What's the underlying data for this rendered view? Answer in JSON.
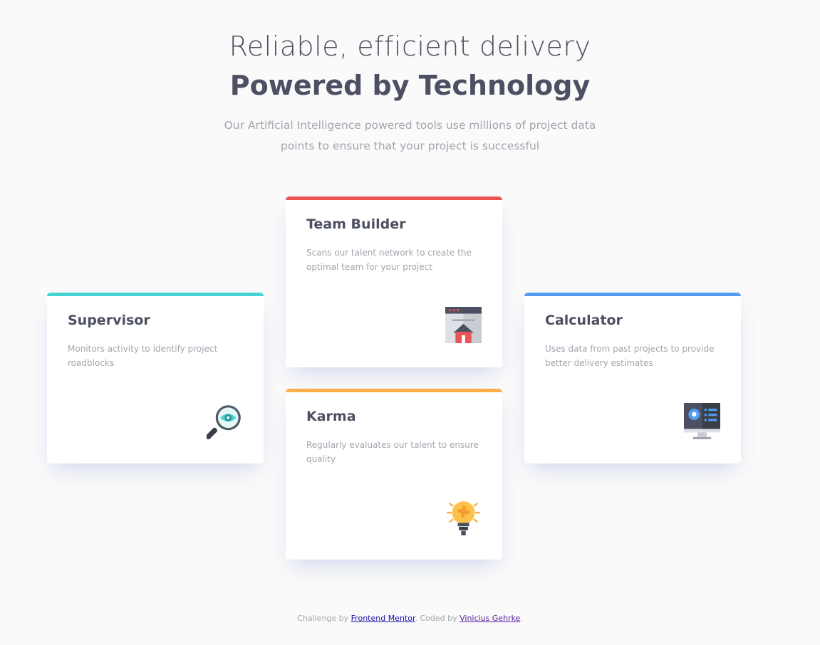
{
  "header": {
    "title_light": "Reliable, efficient delivery",
    "title_bold": "Powered by Technology",
    "subtitle": "Our Artificial Intelligence powered tools use millions of project data points to ensure that your project is successful"
  },
  "cards": {
    "supervisor": {
      "title": "Supervisor",
      "description": "Monitors activity to identify project roadblocks",
      "icon": "magnifier-eye-icon",
      "accent": "#44d3d2"
    },
    "team_builder": {
      "title": "Team Builder",
      "description": "Scans our talent network to create the optimal team for your project",
      "icon": "browser-house-icon",
      "accent": "#ea5454"
    },
    "karma": {
      "title": "Karma",
      "description": "Regularly evaluates our talent to ensure quality",
      "icon": "lightbulb-icon",
      "accent": "#fcae4a"
    },
    "calculator": {
      "title": "Calculator",
      "description": "Uses data from past projects to provide better delivery estimates",
      "icon": "monitor-dashboard-icon",
      "accent": "#549ef2"
    }
  },
  "footer": {
    "prefix": "Challenge by ",
    "mentor_link": "Frontend Mentor",
    "middle": ". Coded by ",
    "author_link": "Vinicius Gehrke",
    "suffix": "."
  }
}
